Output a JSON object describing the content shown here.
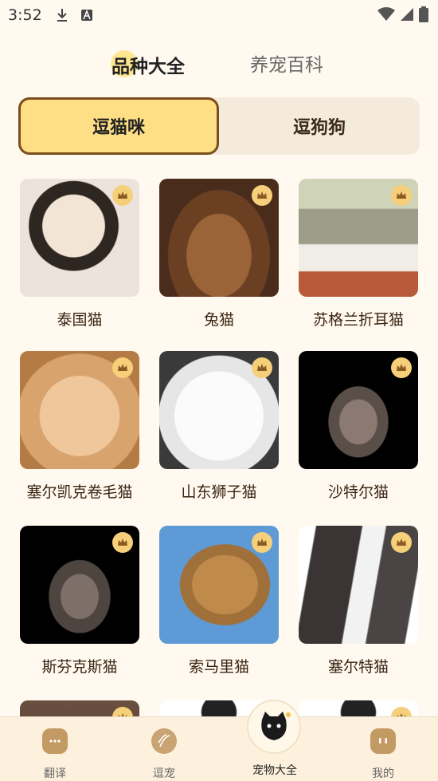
{
  "status_bar": {
    "time": "3:52"
  },
  "top_tabs": {
    "active": "品种大全",
    "inactive": "养宠百科"
  },
  "segment": {
    "cats": "逗猫咪",
    "dogs": "逗狗狗"
  },
  "breeds": [
    {
      "name": "泰国猫"
    },
    {
      "name": "兔猫"
    },
    {
      "name": "苏格兰折耳猫"
    },
    {
      "name": "塞尔凯克卷毛猫"
    },
    {
      "name": "山东狮子猫"
    },
    {
      "name": "沙特尔猫"
    },
    {
      "name": "斯芬克斯猫"
    },
    {
      "name": "索马里猫"
    },
    {
      "name": "塞尔特猫"
    }
  ],
  "bottom_nav": {
    "translate": "翻译",
    "tease": "逗宠",
    "encyclopedia": "宠物大全",
    "mine": "我的"
  },
  "colors": {
    "accent": "#ffdf85",
    "brown": "#7a4e1c",
    "background": "#fff9f0"
  }
}
